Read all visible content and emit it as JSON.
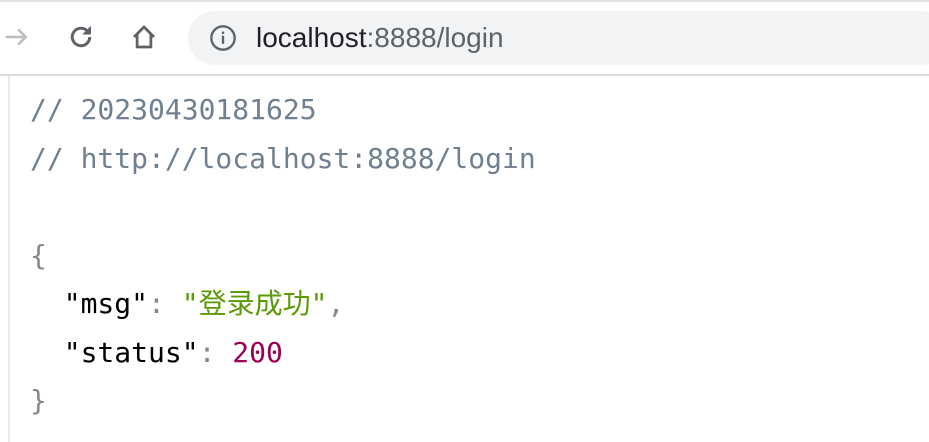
{
  "browser": {
    "url_host": "localhost",
    "url_rest": ":8888/login",
    "icons": [
      "forward-icon",
      "reload-icon",
      "home-icon",
      "info-icon"
    ]
  },
  "content": {
    "comment_timestamp": "// 20230430181625",
    "comment_url": "// http://localhost:8888/login",
    "open_brace": "{",
    "close_brace": "}",
    "fields": [
      {
        "key": "\"msg\"",
        "value": "\"登录成功\"",
        "type": "string"
      },
      {
        "key": "\"status\"",
        "value": "200",
        "type": "number"
      }
    ]
  },
  "colors": {
    "string": "#5c9a08",
    "number": "#990055",
    "comment": "#708090"
  }
}
